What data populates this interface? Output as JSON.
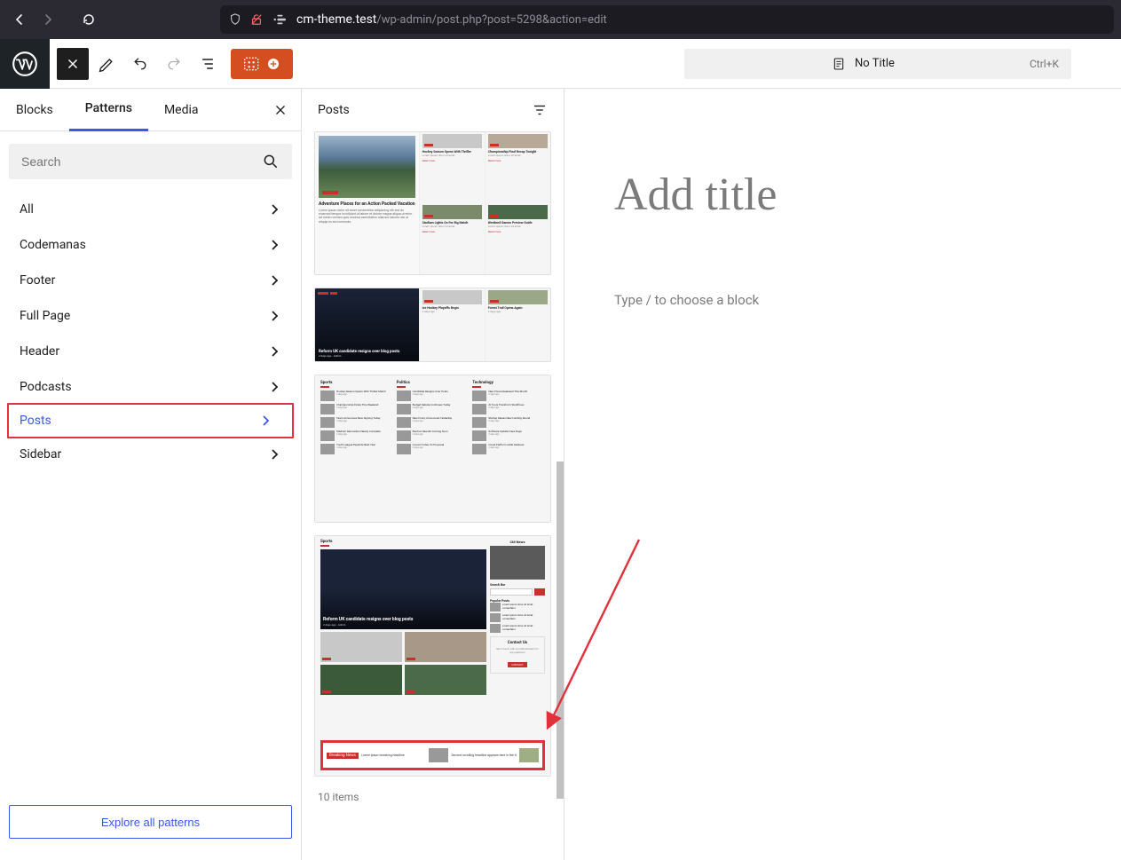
{
  "browser": {
    "url_host": "cm-theme.test",
    "url_path": "/wp-admin/post.php?post=5298&action=edit"
  },
  "editor_header": {
    "title_label": "No Title",
    "shortcut": "Ctrl+K"
  },
  "tabs": {
    "blocks": "Blocks",
    "patterns": "Patterns",
    "media": "Media"
  },
  "search": {
    "placeholder": "Search"
  },
  "categories": [
    {
      "label": "All"
    },
    {
      "label": "Codemanas"
    },
    {
      "label": "Footer"
    },
    {
      "label": "Full Page"
    },
    {
      "label": "Header"
    },
    {
      "label": "Podcasts"
    },
    {
      "label": "Posts",
      "highlighted": true
    },
    {
      "label": "Sidebar"
    }
  ],
  "explore_label": "Explore all patterns",
  "patterns_panel": {
    "title": "Posts",
    "items_count": "10 items",
    "p1_title": "Adventure Places for an Action Packed Vacation",
    "p2_title": "Reform UK candidate resigns over blog posts",
    "p3_cols": [
      "Sports",
      "Politics",
      "Technology"
    ],
    "p4_section": "Sports",
    "p4_hero_title": "Reform UK candidate resigns over blog posts",
    "p4_side_brand": "CM News",
    "p4_side_search": "Search Bar",
    "p4_side_popular": "Popular Posts",
    "p4_contact": "Contact Us",
    "p4_contact_btn": "CONTACT",
    "ticker_badge": "Breaking News"
  },
  "canvas": {
    "title_placeholder": "Add title",
    "block_placeholder": "Type / to choose a block"
  }
}
